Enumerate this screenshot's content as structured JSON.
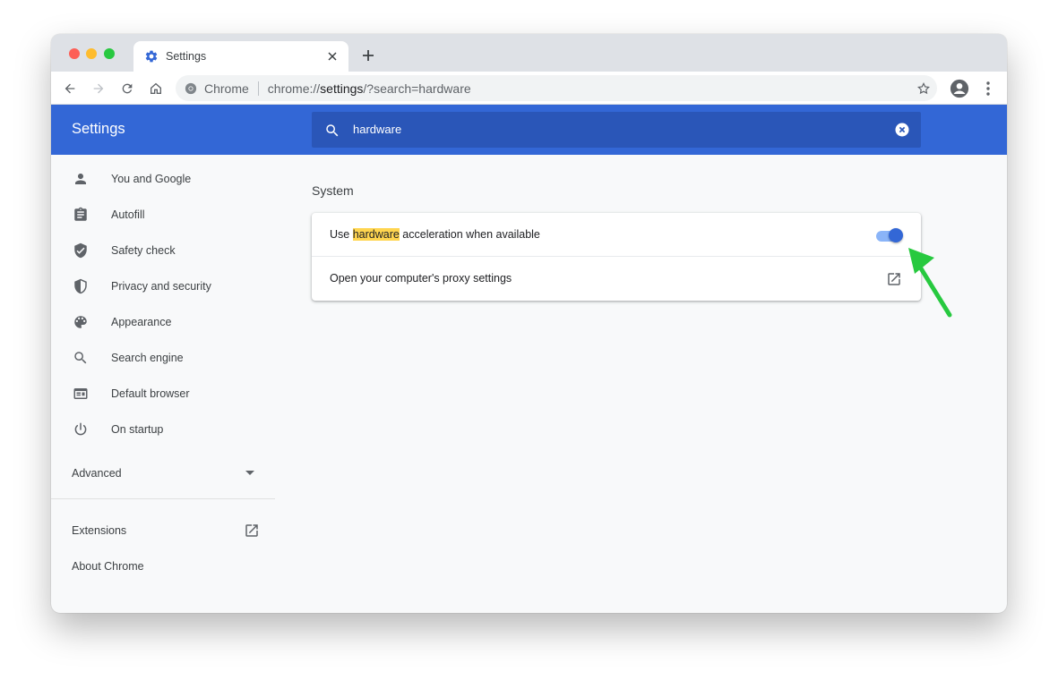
{
  "tab": {
    "title": "Settings"
  },
  "toolbar": {
    "origin_label": "Chrome",
    "url_scheme": "chrome://",
    "url_host": "settings",
    "url_path": "/?search=hardware"
  },
  "header": {
    "title": "Settings"
  },
  "search": {
    "value": "hardware"
  },
  "sidebar": {
    "items": [
      {
        "label": "You and Google",
        "icon": "person-icon"
      },
      {
        "label": "Autofill",
        "icon": "clipboard-icon"
      },
      {
        "label": "Safety check",
        "icon": "shield-check-icon"
      },
      {
        "label": "Privacy and security",
        "icon": "shield-half-icon"
      },
      {
        "label": "Appearance",
        "icon": "palette-icon"
      },
      {
        "label": "Search engine",
        "icon": "search-icon"
      },
      {
        "label": "Default browser",
        "icon": "browser-window-icon"
      },
      {
        "label": "On startup",
        "icon": "power-icon"
      }
    ],
    "advanced_label": "Advanced",
    "extensions_label": "Extensions",
    "about_label": "About Chrome"
  },
  "main": {
    "section_title": "System",
    "rows": {
      "hw_prefix": "Use ",
      "hw_highlight": "hardware",
      "hw_suffix": " acceleration when available",
      "hw_enabled": true,
      "proxy_label": "Open your computer's proxy settings"
    }
  },
  "colors": {
    "header_blue": "#3367d6",
    "search_bg": "#2a56b8",
    "highlight": "#ffd54f",
    "arrow_green": "#27c93f"
  }
}
